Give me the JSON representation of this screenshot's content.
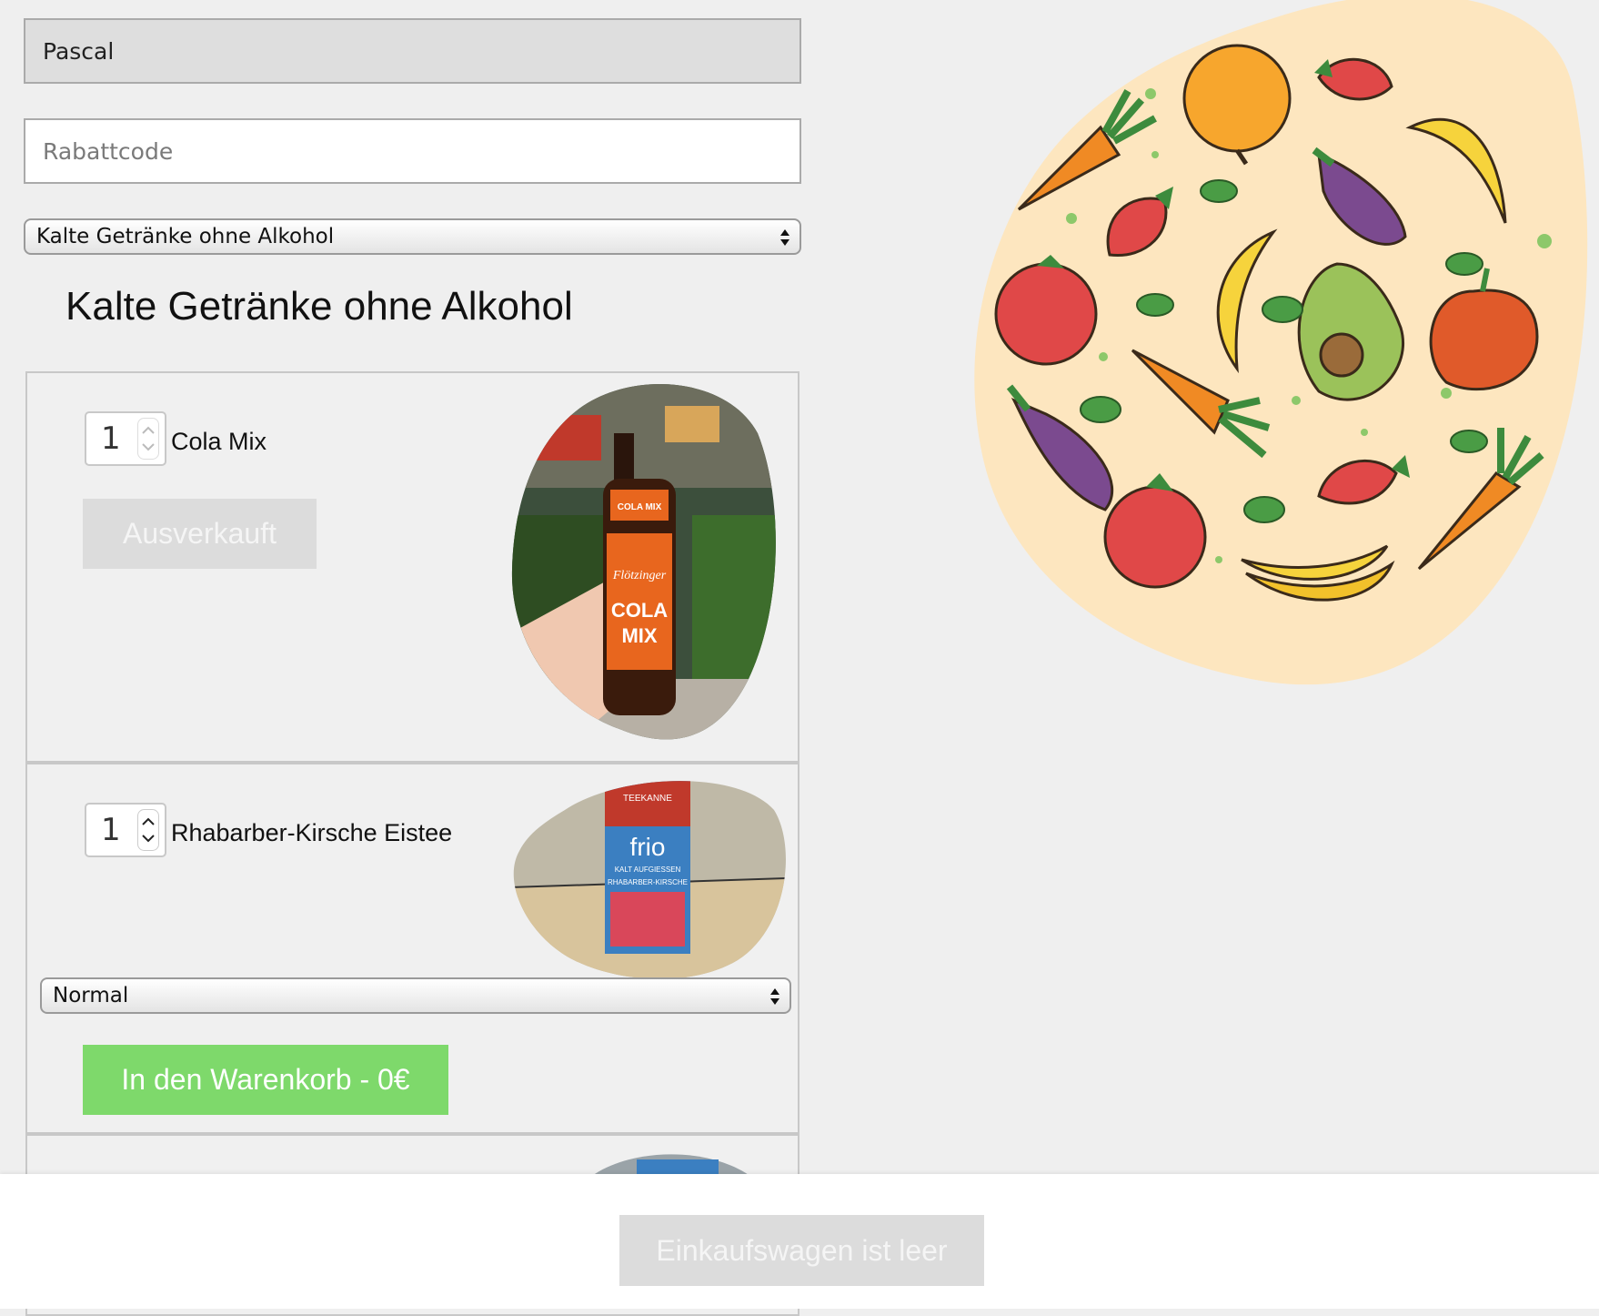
{
  "form": {
    "name_value": "Pascal",
    "discount_placeholder": "Rabattcode",
    "category_select_value": "Kalte Getränke ohne Alkohol"
  },
  "category_title": "Kalte Getränke ohne Alkohol",
  "products": [
    {
      "quantity": "1",
      "name": "Cola Mix",
      "button_label": "Ausverkauft",
      "image_icon": "cola-mix-bottle-photo",
      "image_text": [
        "Flötzinger",
        "COLA MIX"
      ]
    },
    {
      "quantity": "1",
      "name": "Rhabarber-Kirsche Eistee",
      "variant_select_value": "Normal",
      "button_label": "In den Warenkorb - 0€",
      "image_icon": "teekanne-frio-box-photo",
      "image_text": [
        "TEEKANNE",
        "frio",
        "KALT AUFGIESSEN",
        "RHABARBER-KIRSCHE"
      ]
    }
  ],
  "cart": {
    "button_label": "Einkaufswagen ist leer"
  },
  "colors": {
    "background": "#efefef",
    "green_button": "#7ed96b",
    "disabled_button": "#dcdcdc",
    "blob": "#fde6bf"
  },
  "illustration_icon": "fruit-vegetable-blob-illustration"
}
